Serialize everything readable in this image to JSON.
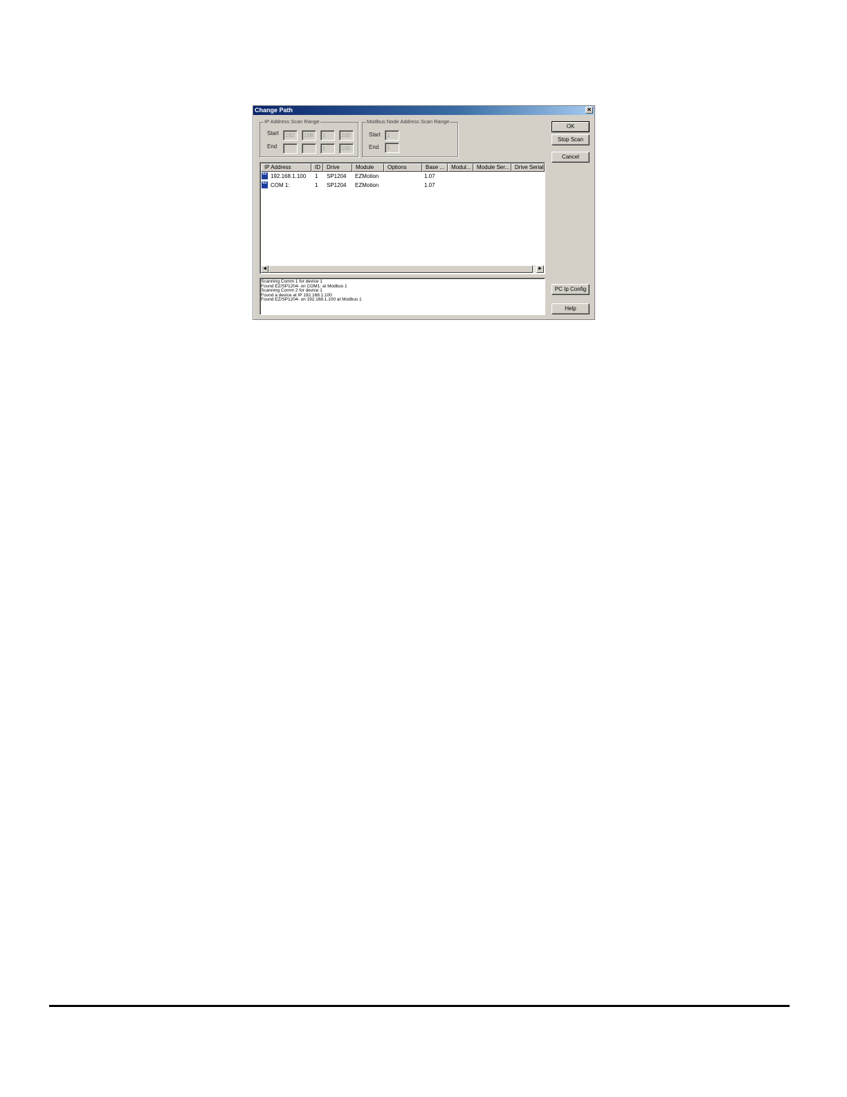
{
  "dialog": {
    "title": "Change Path",
    "close_glyph": "✕"
  },
  "ip_range": {
    "legend": "IP Address Scan Range",
    "start_label": "Start",
    "end_label": "End",
    "start": [
      "192",
      "168",
      "1",
      "100"
    ],
    "end": [
      "",
      "",
      "1",
      "100"
    ]
  },
  "modbus_range": {
    "legend": "Modbus Node Address Scan Range",
    "start_label": "Start",
    "end_label": "End",
    "start": "1",
    "end": "1"
  },
  "buttons": {
    "ok": "OK",
    "stop_scan": "Stop Scan",
    "cancel": "Cancel",
    "pc_ip_config": "PC Ip Config",
    "help": "Help"
  },
  "device_list": {
    "columns": [
      "IP Address",
      "ID",
      "Drive",
      "Module",
      "Options",
      "Base ...",
      "Modul...",
      "Module Ser...",
      "Drive Serial"
    ],
    "rows": [
      {
        "icon": "ez-device-icon",
        "ip": "192.168.1.100",
        "id": "1",
        "drive": "SP1204",
        "module": "EZMotion",
        "options": "",
        "base": "1.07"
      },
      {
        "icon": "ez-device-icon",
        "ip": "COM 1:",
        "id": "1",
        "drive": "SP1204",
        "module": "EZMotion",
        "options": "",
        "base": "1.07"
      }
    ],
    "icon_text": "EZ",
    "scroll_left": "◀",
    "scroll_right": "▶"
  },
  "log": [
    "Scanning Comm 1 for device 1",
    "Found EZ/SP1204- on COM1: at Modbus 1",
    "Scanning Comm 2 for device 1",
    "Found a device at IP 192.168.1.100",
    "Found EZ/SP1204- on 192.168.1.100 at Modbus 1"
  ]
}
